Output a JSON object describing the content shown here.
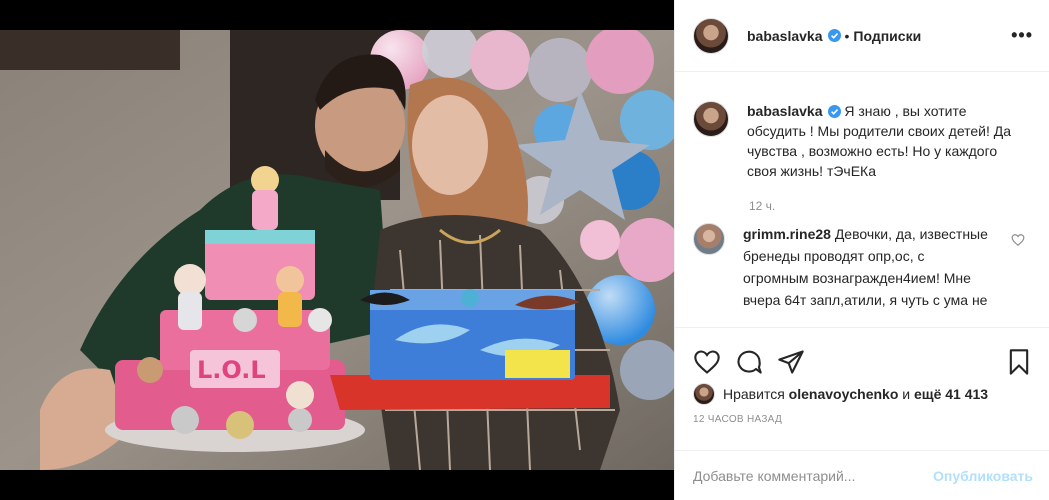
{
  "post": {
    "author": "babaslavka",
    "follow_state": "Подписки",
    "more_icon": "more-options-icon",
    "caption": "Я знаю , вы хотите обсудить ! Мы родители своих детей! Да чувства , возможно есть! Но у каждого своя жизнь! тЭчЕКа",
    "caption_time": "12 ч.",
    "comment": {
      "author": "grimm.rine28",
      "text": "Девочки, да, известные бренеды проводят опр,ос, с огромным вознагражден4ием! Мне вчера 64т запл,атили, я чуть с ума не"
    },
    "likes_prefix": "Нравится",
    "likes_user": "olenavoychenko",
    "likes_and": "и",
    "likes_rest": "ещё 41 413",
    "posted_ago": "12 ЧАСОВ НАЗАД",
    "add_comment_placeholder": "Добавьте комментарий...",
    "publish_label": "Опубликовать"
  },
  "colors": {
    "verified": "#3897f0",
    "publish": "#b2dffc",
    "muted": "#8e8e8e"
  }
}
